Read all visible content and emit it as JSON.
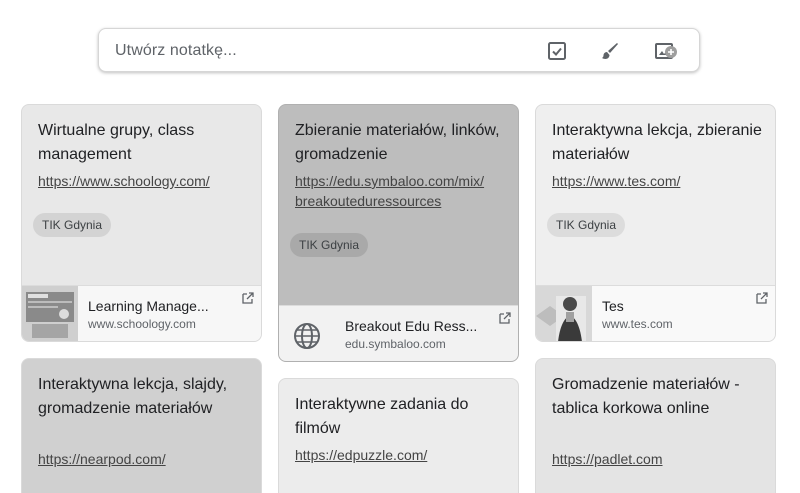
{
  "take_note": {
    "placeholder": "Utwórz notatkę...",
    "icons": [
      "checkbox-icon",
      "brush-icon",
      "image-icon"
    ]
  },
  "notes": [
    {
      "title": "Wirtualne grupy, class management",
      "url": "https://www.schoology.com/",
      "label": "TIK Gdynia",
      "link_title": "Learning Manage...",
      "link_domain": "www.schoology.com",
      "color": "#e8e8e8"
    },
    {
      "title": "Zbieranie materiałów, linków, gromadzenie",
      "url": "https://edu.symbaloo.com/mix/breakoutedu­ressources",
      "url_line1": "https://edu.symbaloo.com/mix/",
      "url_line2": "breakoutedu­ressources",
      "label": "TIK Gdynia",
      "link_title": "Breakout Edu Ress...",
      "link_domain": "edu.symbaloo.com",
      "color": "#bdbdbd"
    },
    {
      "title": "Interaktywna lekcja, zbieranie materiałów",
      "url": "https://www.tes.com/",
      "label": "TIK Gdynia",
      "link_title": "Tes",
      "link_domain": "www.tes.com",
      "color": "#efefef"
    },
    {
      "title": "Interaktywna lekcja, slajdy, gromadzenie materiałów",
      "url": "https://nearpod.com/",
      "color": "#d0d0d0"
    },
    {
      "title": "Interaktywne zadania do filmów",
      "url": "https://edpuzzle.com/",
      "color": "#ececec"
    },
    {
      "title": "Gromadzenie materiałów - tablica korkowa online",
      "url": "https://padlet.com",
      "color": "#e4e4e4"
    }
  ]
}
